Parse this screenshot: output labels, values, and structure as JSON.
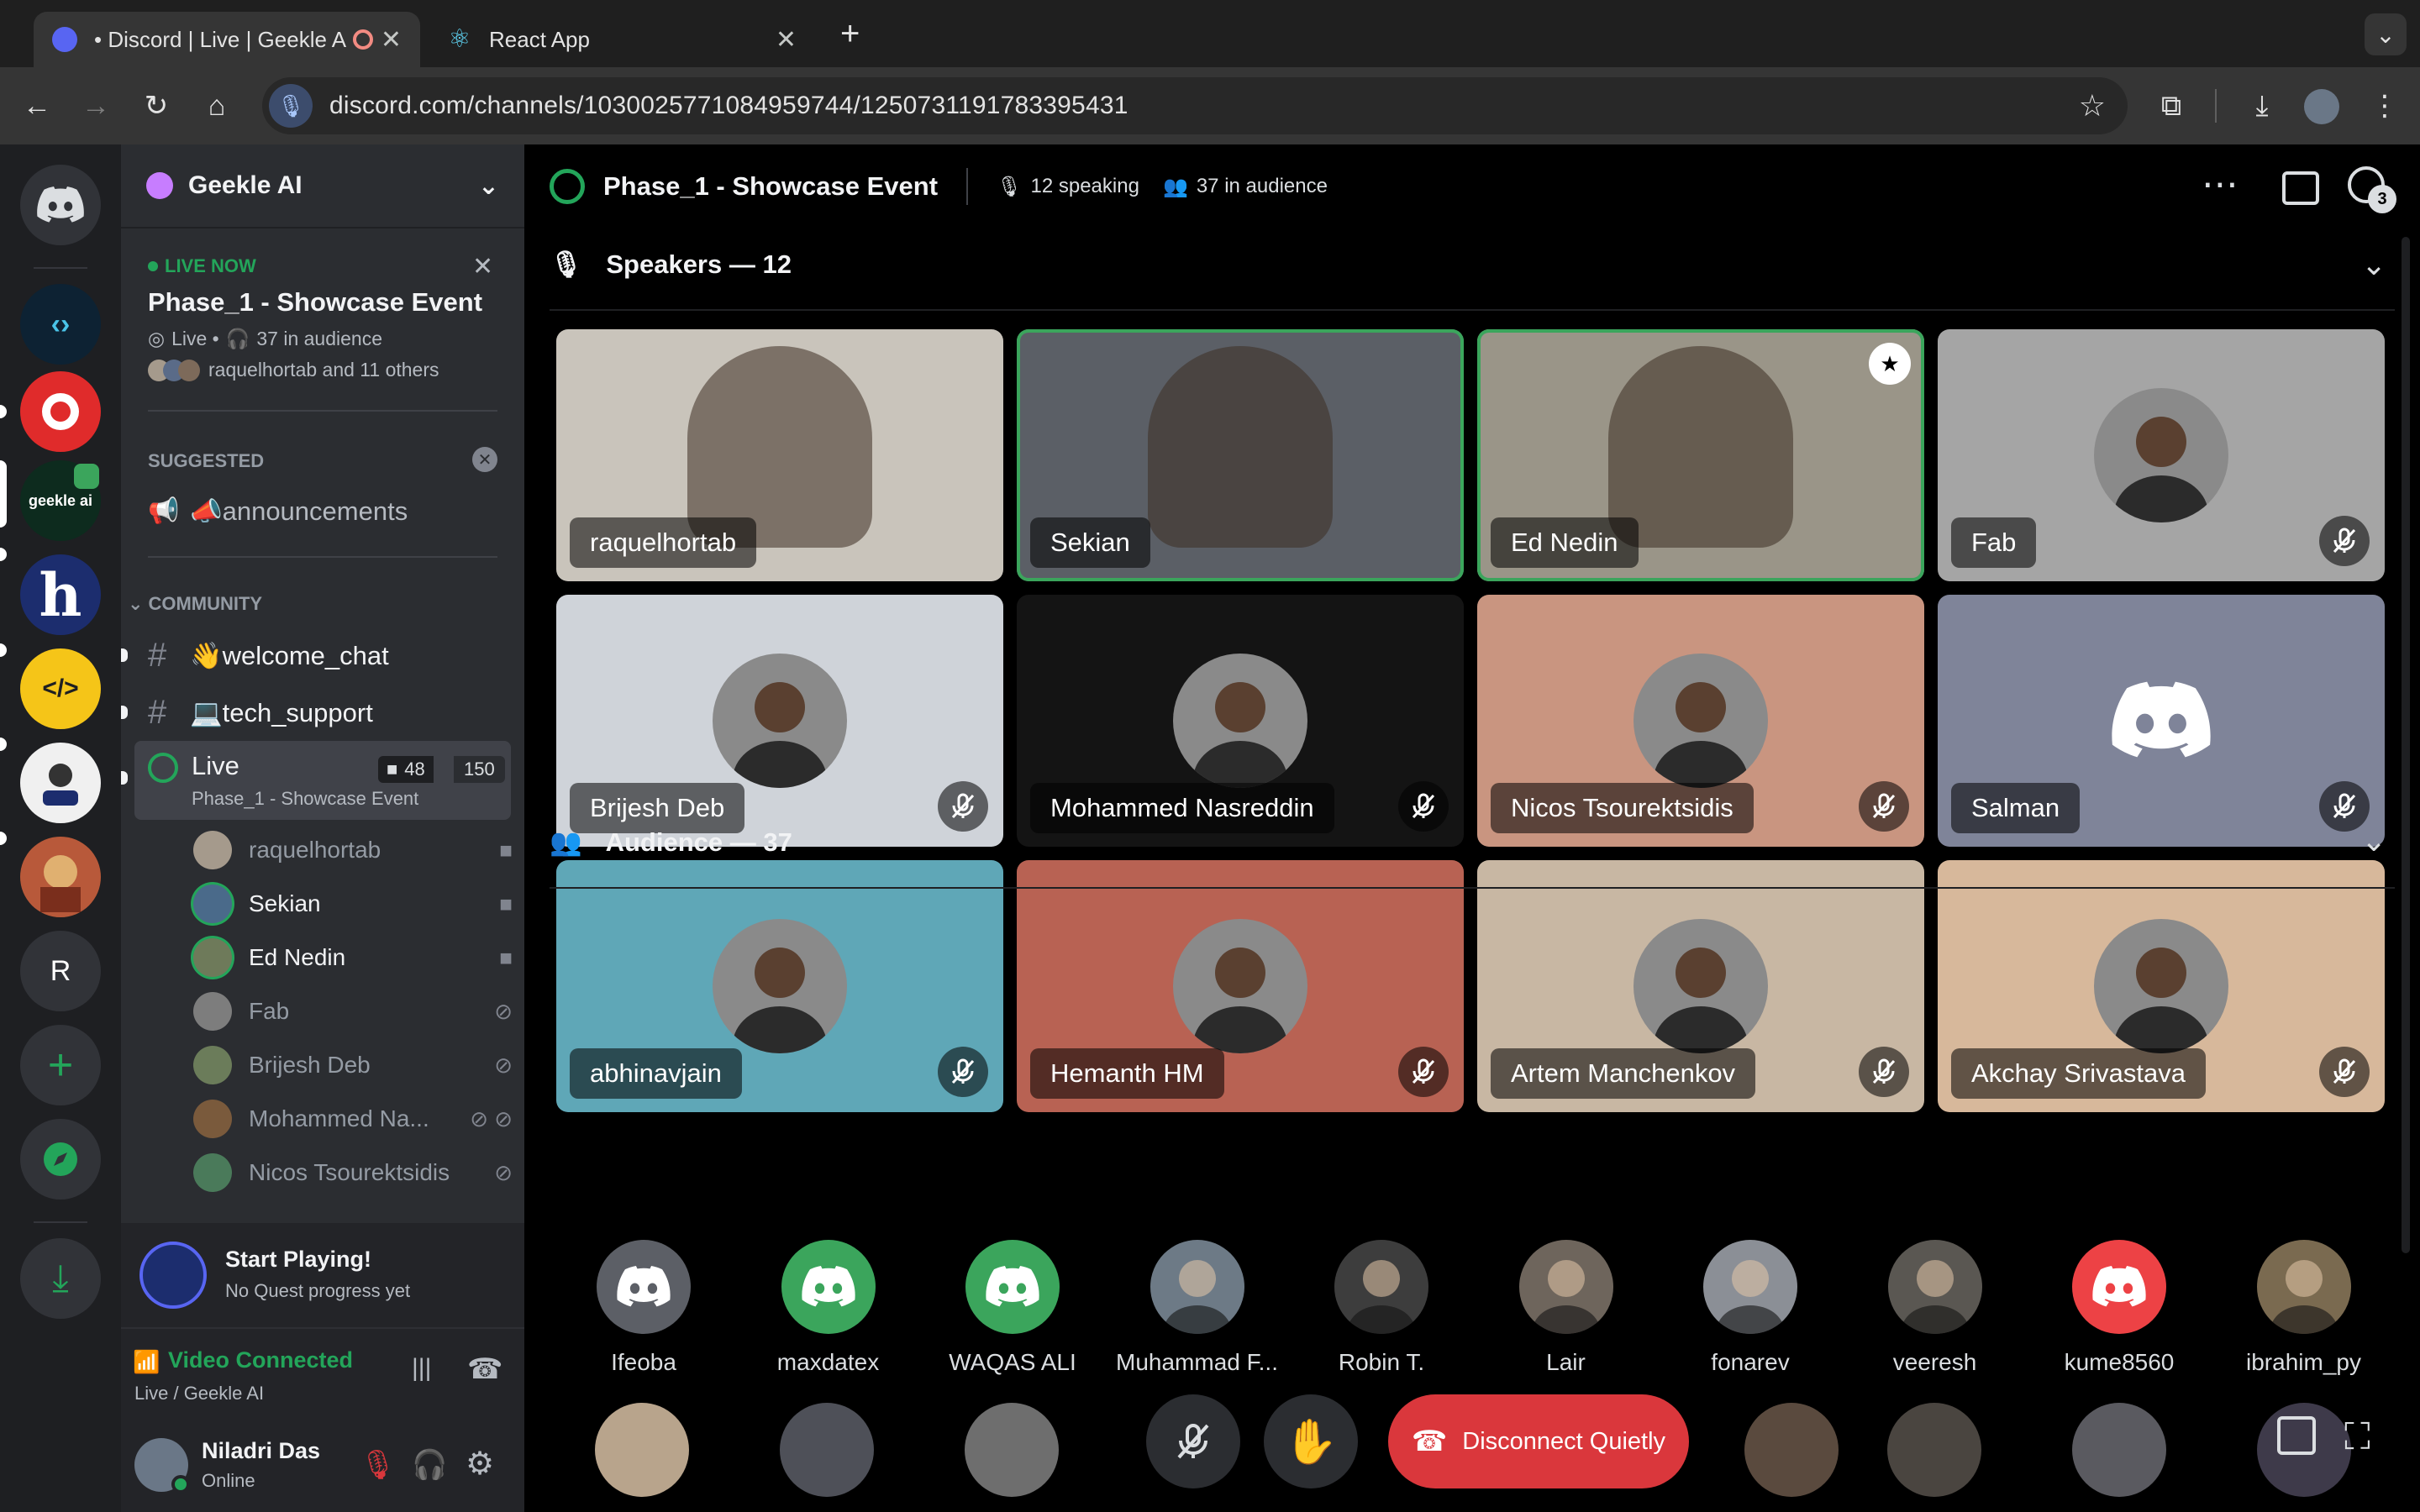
{
  "browser": {
    "tabs": [
      {
        "title": "• Discord | Live | Geekle A"
      },
      {
        "title": "React App"
      }
    ],
    "new_tab": "+",
    "url": "discord.com/channels/1030025771084959744/1250731191783395431"
  },
  "rail": {
    "servers": [
      {
        "name": "geekle ai"
      },
      {
        "name": "R"
      }
    ]
  },
  "sidebar": {
    "guild_name": "Geekle AI",
    "live_banner": {
      "badge": "LIVE NOW",
      "title": "Phase_1 - Showcase Event",
      "meta_live": "Live •",
      "meta_audience": "37 in audience",
      "participants": "raquelhortab and 11 others"
    },
    "suggested": {
      "header": "SUGGESTED",
      "item": "📣announcements"
    },
    "category": "COMMUNITY",
    "channels": [
      {
        "name": "👋welcome_chat"
      },
      {
        "name": "💻tech_support"
      }
    ],
    "live_channel": {
      "name": "Live",
      "topic": "Phase_1 - Showcase Event",
      "video_count": "48",
      "limit": "150"
    },
    "members": [
      {
        "name": "raquelhortab"
      },
      {
        "name": "Sekian"
      },
      {
        "name": "Ed Nedin"
      },
      {
        "name": "Fab"
      },
      {
        "name": "Brijesh Deb"
      },
      {
        "name": "Mohammed Na..."
      },
      {
        "name": "Nicos Tsourektsidis"
      }
    ],
    "quest": {
      "title": "Start Playing!",
      "subtitle": "No Quest progress yet"
    },
    "voice": {
      "status": "Video Connected",
      "location": "Live / Geekle AI"
    },
    "user": {
      "name": "Niladri Das",
      "status": "Online"
    }
  },
  "stage": {
    "title": "Phase_1 - Showcase Event",
    "speaking": "12 speaking",
    "audience": "37 in audience",
    "inbox_badge": "3",
    "speakers_header": "Speakers — 12",
    "audience_header": "Audience — 37",
    "speakers": [
      {
        "name": "raquelhortab",
        "bg": "#c9c4bb"
      },
      {
        "name": "Sekian",
        "bg": "#5b5f66"
      },
      {
        "name": "Ed Nedin",
        "bg": "#9a9588"
      },
      {
        "name": "Fab",
        "bg": "#a5a5a5"
      },
      {
        "name": "Brijesh Deb",
        "bg": "#cfd3d9"
      },
      {
        "name": "Mohammed Nasreddin",
        "bg": "#141414"
      },
      {
        "name": "Nicos Tsourektsidis",
        "bg": "#c99580"
      },
      {
        "name": "Salman",
        "bg": "#7f8499"
      },
      {
        "name": "abhinavjain",
        "bg": "#5fa7b7"
      },
      {
        "name": "Hemanth HM",
        "bg": "#b86253"
      },
      {
        "name": "Artem Manchenkov",
        "bg": "#c8b7a3"
      },
      {
        "name": "Akchay Srivastava",
        "bg": "#d7b89b"
      }
    ],
    "audience_members": [
      {
        "name": "Ifeoba",
        "bg": "#5c5f66"
      },
      {
        "name": "maxdatex",
        "bg": "#3ba55c"
      },
      {
        "name": "WAQAS ALI",
        "bg": "#3ba55c"
      },
      {
        "name": "Muhammad F...",
        "bg": "#6d7a86"
      },
      {
        "name": "Robin T.",
        "bg": "#3d3d3d"
      },
      {
        "name": "Lair",
        "bg": "#6e655c"
      },
      {
        "name": "fonarev",
        "bg": "#8b8f96"
      },
      {
        "name": "veeresh",
        "bg": "#5a5752"
      },
      {
        "name": "kume8560",
        "bg": "#ed4245"
      },
      {
        "name": "ibrahim_py",
        "bg": "#7a6a50"
      }
    ],
    "disconnect_label": "Disconnect Quietly"
  },
  "colors": {
    "green": "#3ba55c",
    "red": "#da373c",
    "sidebar": "#2b2d31",
    "rail": "#1e1f22"
  }
}
